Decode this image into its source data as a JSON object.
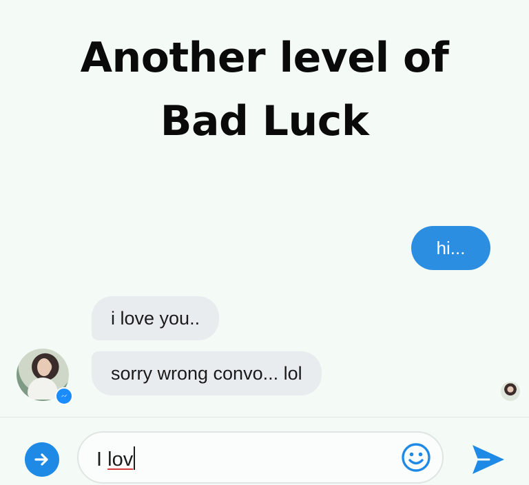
{
  "caption": {
    "line1": "Another level of",
    "line2": "Bad Luck"
  },
  "conversation": {
    "outgoing": [
      {
        "text": "hi..."
      }
    ],
    "incoming": [
      {
        "text": "i love you.."
      },
      {
        "text": "sorry wrong convo... lol"
      }
    ]
  },
  "composer": {
    "typed_prefix": "I ",
    "typed_misspelled": "lov"
  },
  "icons": {
    "expand": "arrow-right-circle-icon",
    "emoji": "smiley-icon",
    "send": "send-icon",
    "messenger_badge": "messenger-icon"
  },
  "colors": {
    "accent": "#2b8ee0",
    "incoming_bubble": "#e9ecee",
    "background": "#f4faf6"
  }
}
